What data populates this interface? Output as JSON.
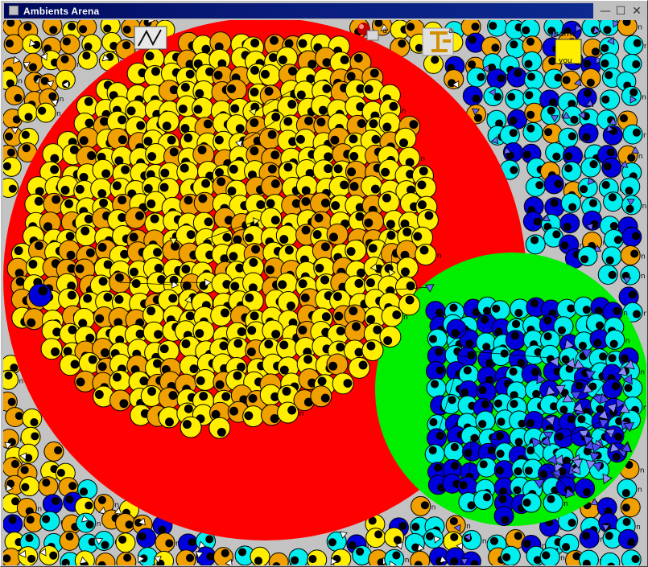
{
  "window": {
    "title": "Ambients Arena",
    "controls": {
      "minimize": "—",
      "maximize": "☐",
      "close": "✕"
    }
  },
  "arena": {
    "background_color": "#c3c3c3",
    "regions": [
      {
        "id": "red-ambient",
        "color": "#ff0000"
      },
      {
        "id": "green-ambient",
        "color": "#00ee00"
      }
    ],
    "agent_colors": {
      "yellow": "#ffee00",
      "orange": "#f0a000",
      "cyan": "#00eeee",
      "blue": "#0000dd",
      "eye": "#000000"
    },
    "agent_label": "n",
    "widgets": {
      "sphere_label": "a",
      "crane_label": "a",
      "name_tag_label": "name",
      "yellow_box_label": "you",
      "tool_icon": "zoom-tool-icon",
      "sphere_icon": "red-sphere-icon",
      "crane_icon": "crane-icon"
    }
  }
}
